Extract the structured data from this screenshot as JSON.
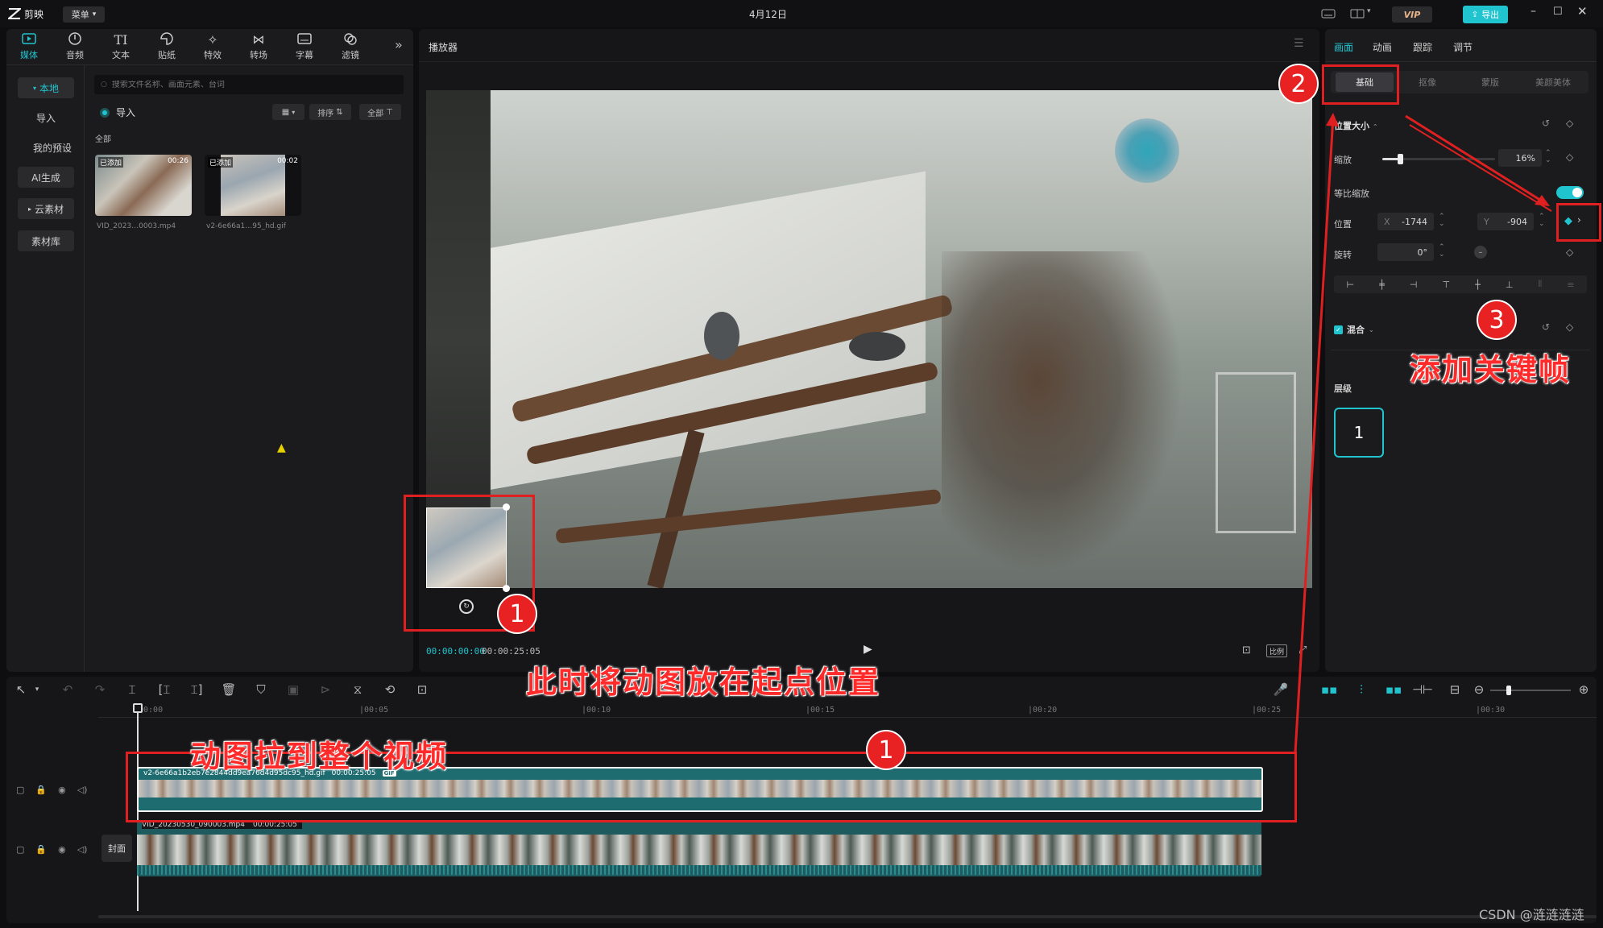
{
  "titlebar": {
    "app_name": "剪映",
    "menu_label": "菜单",
    "title": "4月12日",
    "vip_label": "VIP",
    "export_label": "导出"
  },
  "toolbar": {
    "items": [
      {
        "label": "媒体",
        "icon": "media-icon"
      },
      {
        "label": "音频",
        "icon": "audio-icon"
      },
      {
        "label": "文本",
        "icon": "text-icon"
      },
      {
        "label": "贴纸",
        "icon": "sticker-icon"
      },
      {
        "label": "特效",
        "icon": "effects-icon"
      },
      {
        "label": "转场",
        "icon": "transition-icon"
      },
      {
        "label": "字幕",
        "icon": "subtitle-icon"
      },
      {
        "label": "滤镜",
        "icon": "filter-icon"
      }
    ],
    "more": "»"
  },
  "sidebar": {
    "items": [
      "本地",
      "导入",
      "我的预设",
      "AI生成",
      "云素材",
      "素材库"
    ]
  },
  "media": {
    "search_placeholder": "搜索文件名称、画面元素、台词",
    "import_label": "导入",
    "sort_label": "排序",
    "filter_label": "全部",
    "section_label": "全部",
    "thumbs": [
      {
        "badge": "已添加",
        "duration": "00:26",
        "name": "VID_2023…0003.mp4"
      },
      {
        "badge": "已添加",
        "duration": "00:02",
        "name": "v2-6e66a1…95_hd.gif"
      }
    ]
  },
  "player": {
    "title": "播放器",
    "current_time": "00:00:00:00",
    "total_time": "00:00:25:05",
    "ratio_label": "比例"
  },
  "inspector": {
    "tabs": [
      "画面",
      "动画",
      "跟踪",
      "调节"
    ],
    "subtabs": [
      "基础",
      "抠像",
      "蒙版",
      "美颜美体"
    ],
    "section_position": "位置大小",
    "scale_label": "缩放",
    "scale_value": "16%",
    "scale_fraction": 0.16,
    "uniform_label": "等比缩放",
    "position_label": "位置",
    "pos_x_label": "X",
    "pos_x": "-1744",
    "pos_y_label": "Y",
    "pos_y": "-904",
    "rotate_label": "旋转",
    "rotate_value": "0°",
    "blend_label": "混合",
    "layer_label": "层级",
    "layer_value": "1"
  },
  "timeline": {
    "ruler": [
      "00:00",
      "|00:05",
      "|00:10",
      "|00:15",
      "|00:20",
      "|00:25",
      "|00:30"
    ],
    "gif_clip_title": "v2-6e66a1b2eb7e2844dd9ea76d4d95dc95_hd.gif",
    "gif_clip_time": "00:00:25:05",
    "gif_badge": "GIF",
    "video_clip_title": "VID_20230530_090003.mp4",
    "video_clip_time": "00:00:25:05",
    "cover_label": "封面"
  },
  "annotations": {
    "num1": "1",
    "num2": "2",
    "num3": "3",
    "add_keyframe": "添加关键帧",
    "place_start": "此时将动图放在起点位置",
    "stretch": "动图拉到整个视频"
  },
  "watermark": "CSDN @涟涟涟涟",
  "colors": {
    "accent": "#20c4cf",
    "annotation": "#e82222",
    "gif_track": "#1e6b70"
  }
}
